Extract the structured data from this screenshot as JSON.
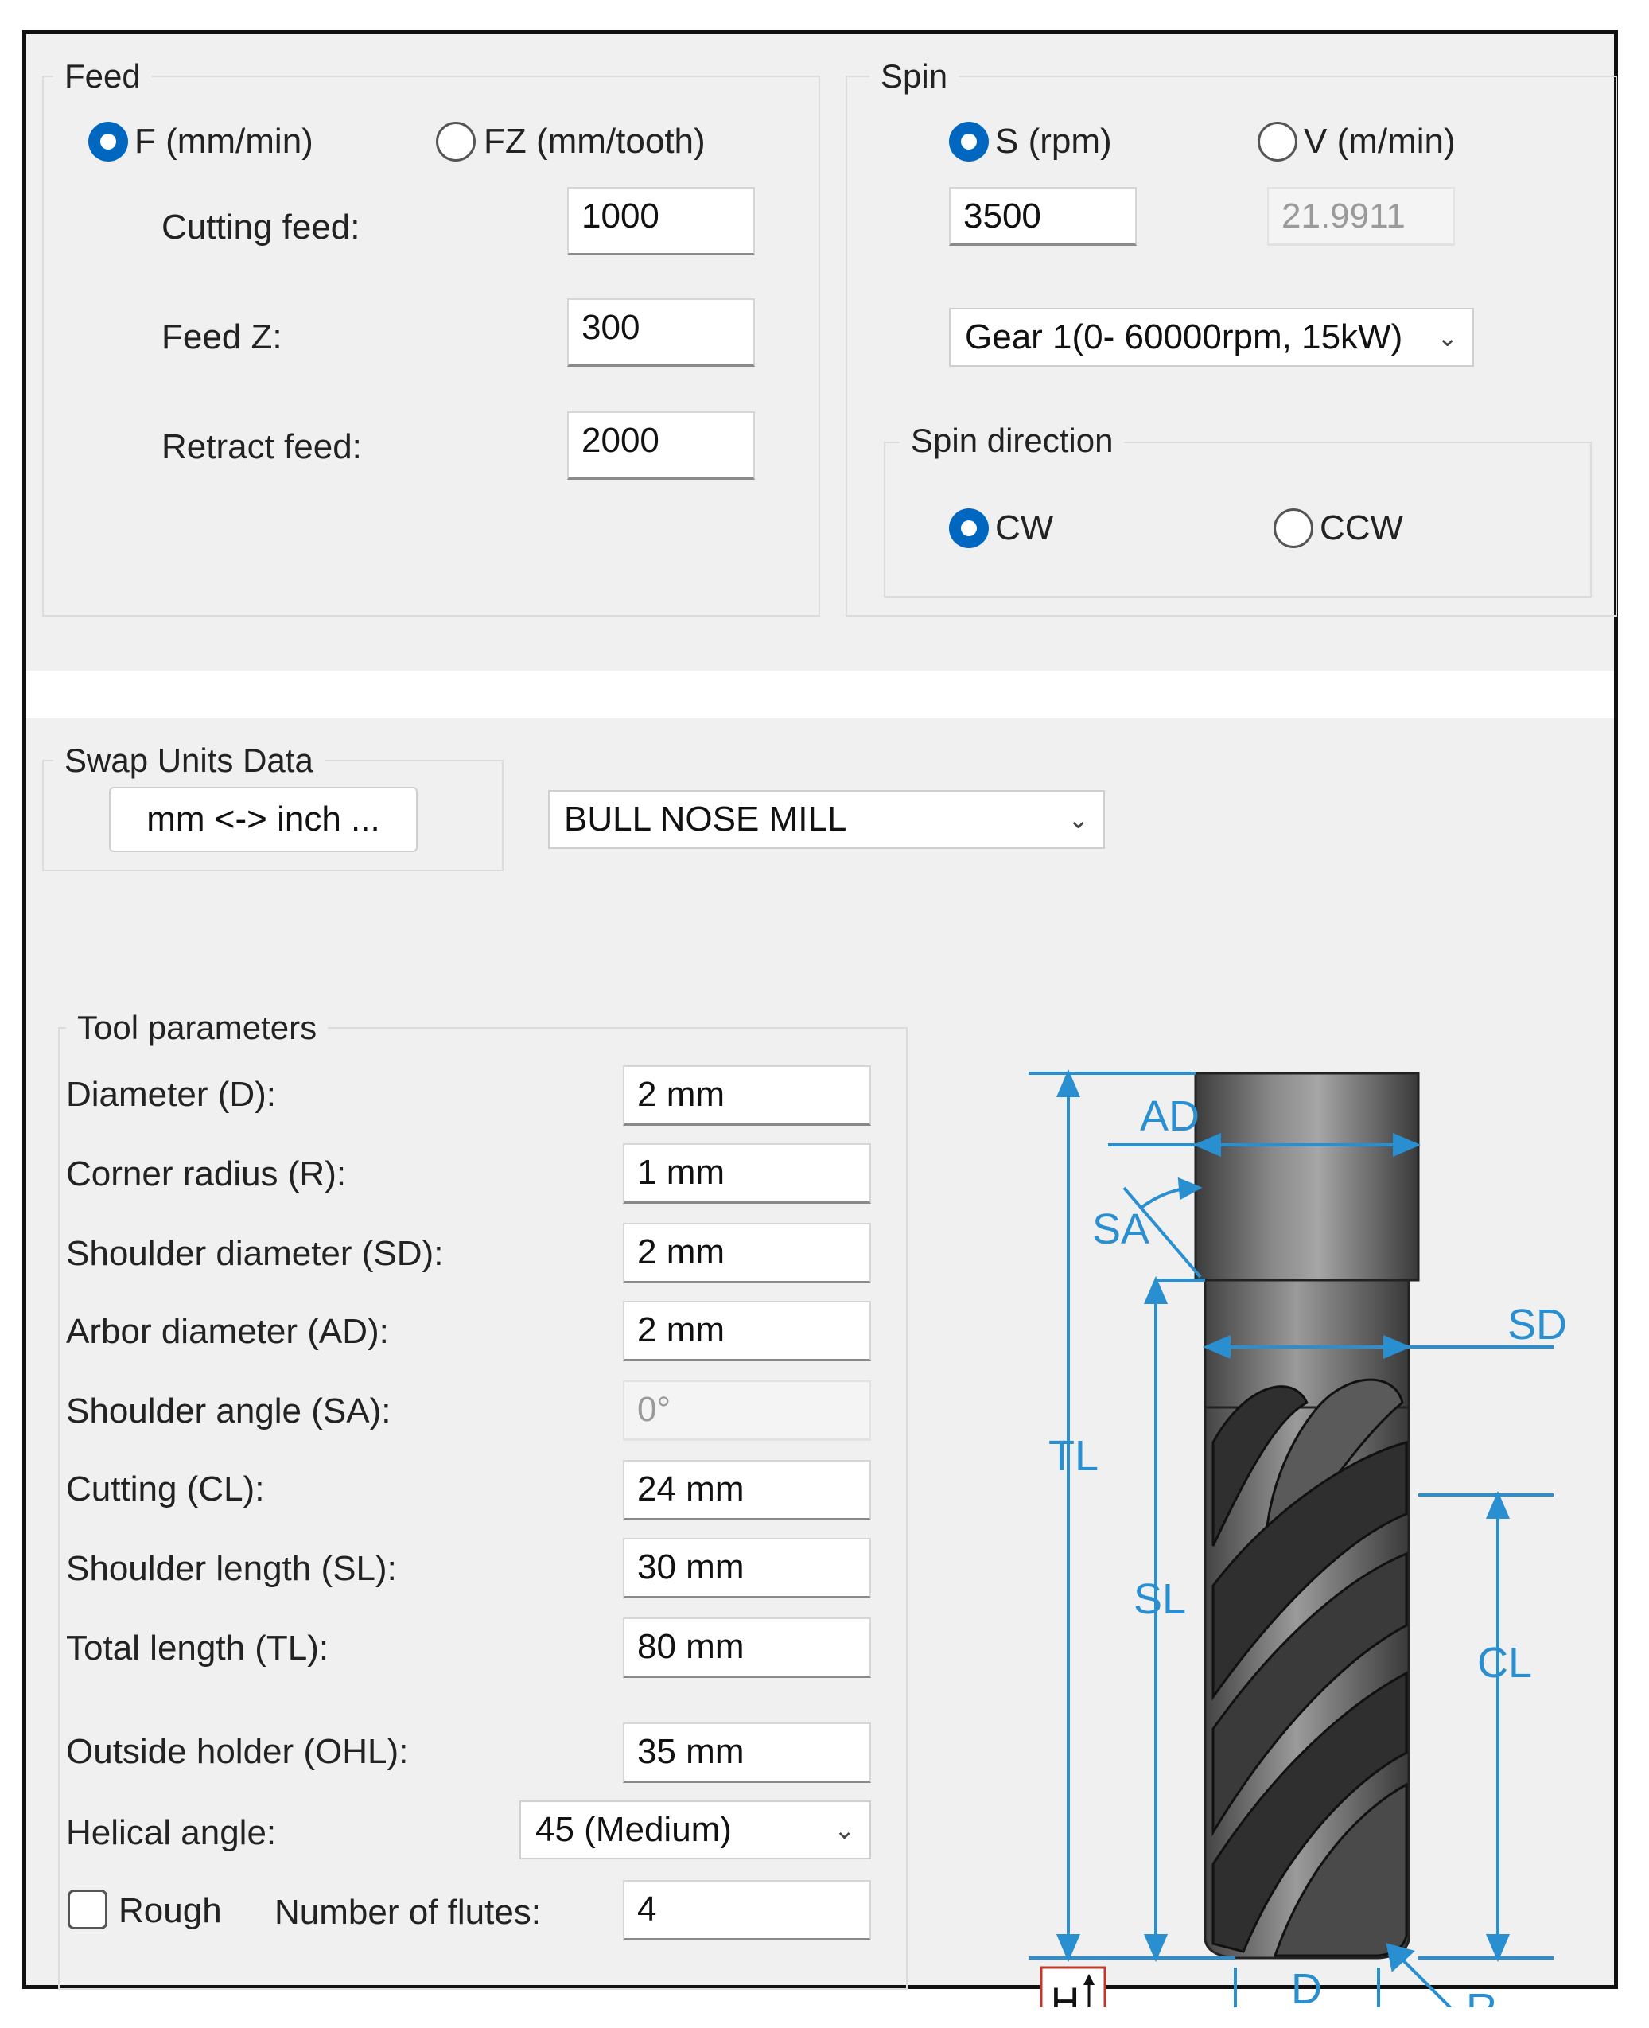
{
  "feed": {
    "title": "Feed",
    "radio_f": "F (mm/min)",
    "radio_fz": "FZ (mm/tooth)",
    "cutting_feed_label": "Cutting feed:",
    "cutting_feed_value": "1000",
    "feed_z_label": "Feed Z:",
    "feed_z_value": "300",
    "retract_feed_label": "Retract feed:",
    "retract_feed_value": "2000"
  },
  "spin": {
    "title": "Spin",
    "radio_s": "S (rpm)",
    "radio_v": "V (m/min)",
    "s_value": "3500",
    "v_value": "21.9911",
    "gear": "Gear 1(0- 60000rpm, 15kW)",
    "direction_title": "Spin direction",
    "cw": "CW",
    "ccw": "CCW"
  },
  "swap": {
    "title": "Swap Units Data",
    "button": "mm <-> inch ...",
    "tool_type": "BULL NOSE MILL"
  },
  "tool": {
    "title": "Tool parameters",
    "params": [
      {
        "label": "Diameter (D):",
        "value": "2 mm"
      },
      {
        "label": "Corner radius (R):",
        "value": "1 mm"
      },
      {
        "label": "Shoulder diameter (SD):",
        "value": "2 mm"
      },
      {
        "label": "Arbor diameter (AD):",
        "value": "2 mm"
      },
      {
        "label": "Shoulder angle (SA):",
        "value": "0°"
      },
      {
        "label": "Cutting (CL):",
        "value": "24 mm"
      },
      {
        "label": "Shoulder length (SL):",
        "value": "30 mm"
      },
      {
        "label": "Total length (TL):",
        "value": "80 mm"
      },
      {
        "label": "Outside holder (OHL):",
        "value": "35 mm"
      }
    ],
    "helical_label": "Helical angle:",
    "helical_value": "45 (Medium)",
    "rough_label": "Rough",
    "flutes_label": "Number of flutes:",
    "flutes_value": "4"
  },
  "diagram": {
    "AD": "AD",
    "SA": "SA",
    "SD": "SD",
    "TL": "TL",
    "SL": "SL",
    "CL": "CL",
    "D": "D",
    "R": "R",
    "H": "H"
  },
  "colors": {
    "accent": "#0067c0",
    "dimension": "#2a8fd0"
  }
}
